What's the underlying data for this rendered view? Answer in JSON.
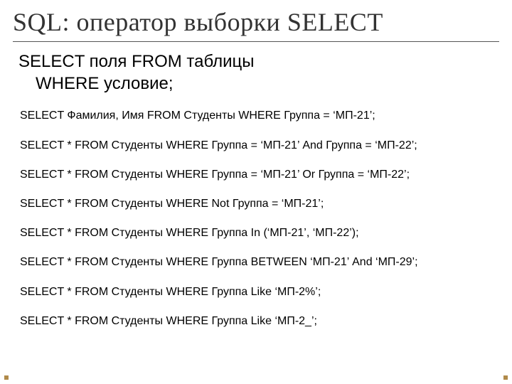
{
  "title": "SQL: оператор выборки SELECT",
  "syntax": {
    "line1": "SELECT поля FROM таблицы",
    "line2": "WHERE условие;"
  },
  "examples": [
    "SELECT Фамилия, Имя FROM Студенты WHERE Группа = ‘МП-21’;",
    "SELECT * FROM Студенты WHERE Группа = ‘МП-21’ And Группа = ‘МП-22’;",
    "SELECT * FROM Студенты WHERE Группа = ‘МП-21’ Or Группа = ‘МП-22’;",
    "SELECT * FROM Студенты WHERE Not Группа = ‘МП-21’;",
    "SELECT * FROM Студенты WHERE Группа In (‘МП-21’, ‘МП-22’);",
    "SELECT * FROM Студенты WHERE Группа BETWEEN ‘МП-21’ And ‘МП-29’;",
    "SELECT * FROM Студенты WHERE Группа Like ‘МП-2%’;",
    "SELECT * FROM Студенты WHERE Группа Like ‘МП-2_’;"
  ]
}
